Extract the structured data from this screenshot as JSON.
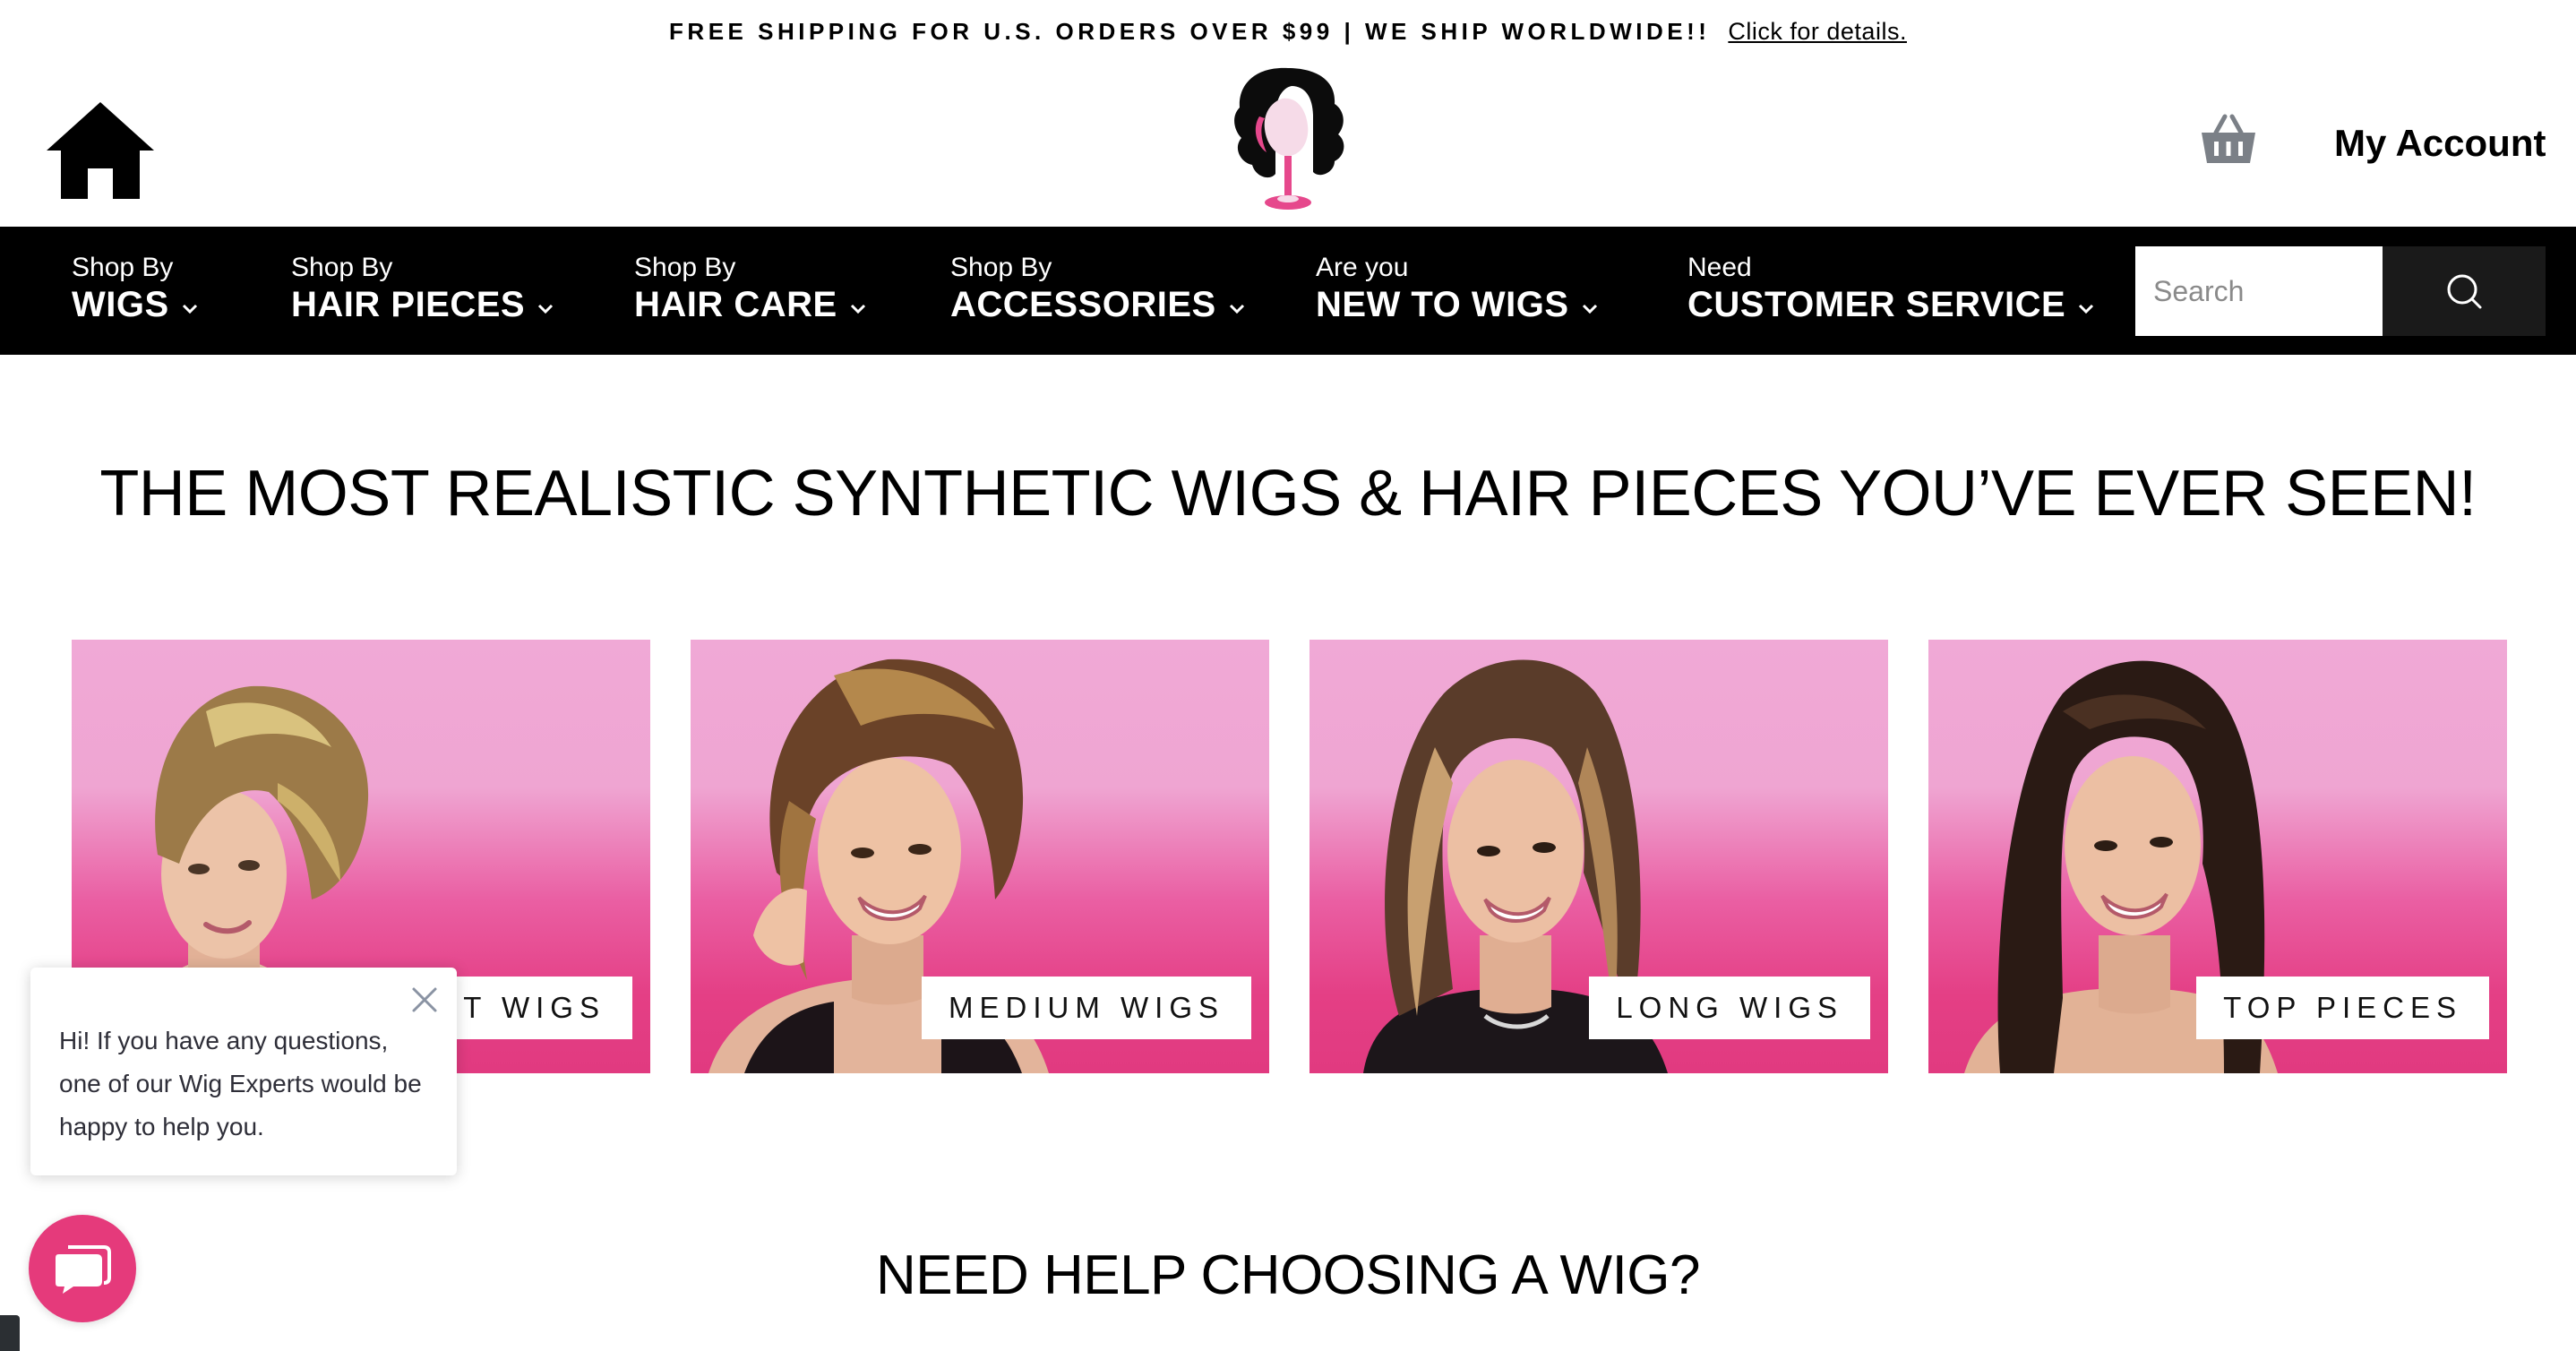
{
  "announcement": {
    "text": "FREE SHIPPING FOR U.S. ORDERS OVER $99 | WE SHIP WORLDWIDE!!",
    "link": "Click for details."
  },
  "header": {
    "home_icon": "home-icon",
    "logo_icon": "wig-stand-logo",
    "cart_icon": "shopping-basket-icon",
    "account_label": "My Account"
  },
  "nav": {
    "items": [
      {
        "small": "Shop By",
        "big": "WIGS"
      },
      {
        "small": "Shop By",
        "big": "HAIR PIECES"
      },
      {
        "small": "Shop By",
        "big": "HAIR CARE"
      },
      {
        "small": "Shop By",
        "big": "ACCESSORIES"
      },
      {
        "small": "Are you",
        "big": "NEW TO WIGS"
      },
      {
        "small": "Need",
        "big": "CUSTOMER SERVICE"
      }
    ],
    "search_placeholder": "Search",
    "search_icon": "search-icon"
  },
  "main": {
    "headline": "THE MOST REALISTIC SYNTHETIC WIGS & HAIR PIECES YOU’VE EVER SEEN!",
    "tiles": [
      {
        "label": "SHORT WIGS"
      },
      {
        "label": "MEDIUM WIGS"
      },
      {
        "label": "LONG WIGS"
      },
      {
        "label": "TOP PIECES"
      }
    ],
    "subheadline": "NEED HELP CHOOSING A WIG?"
  },
  "chat": {
    "message": "Hi! If you have any questions, one of our Wig Experts would be happy to help you.",
    "close_icon": "close-icon",
    "launcher_icon": "chat-bubble-icon"
  },
  "colors": {
    "nav_bg": "#000000",
    "tile_pink_top": "#f0a9d6",
    "tile_pink_bottom": "#e13a80",
    "chat_accent": "#e53a7b"
  }
}
